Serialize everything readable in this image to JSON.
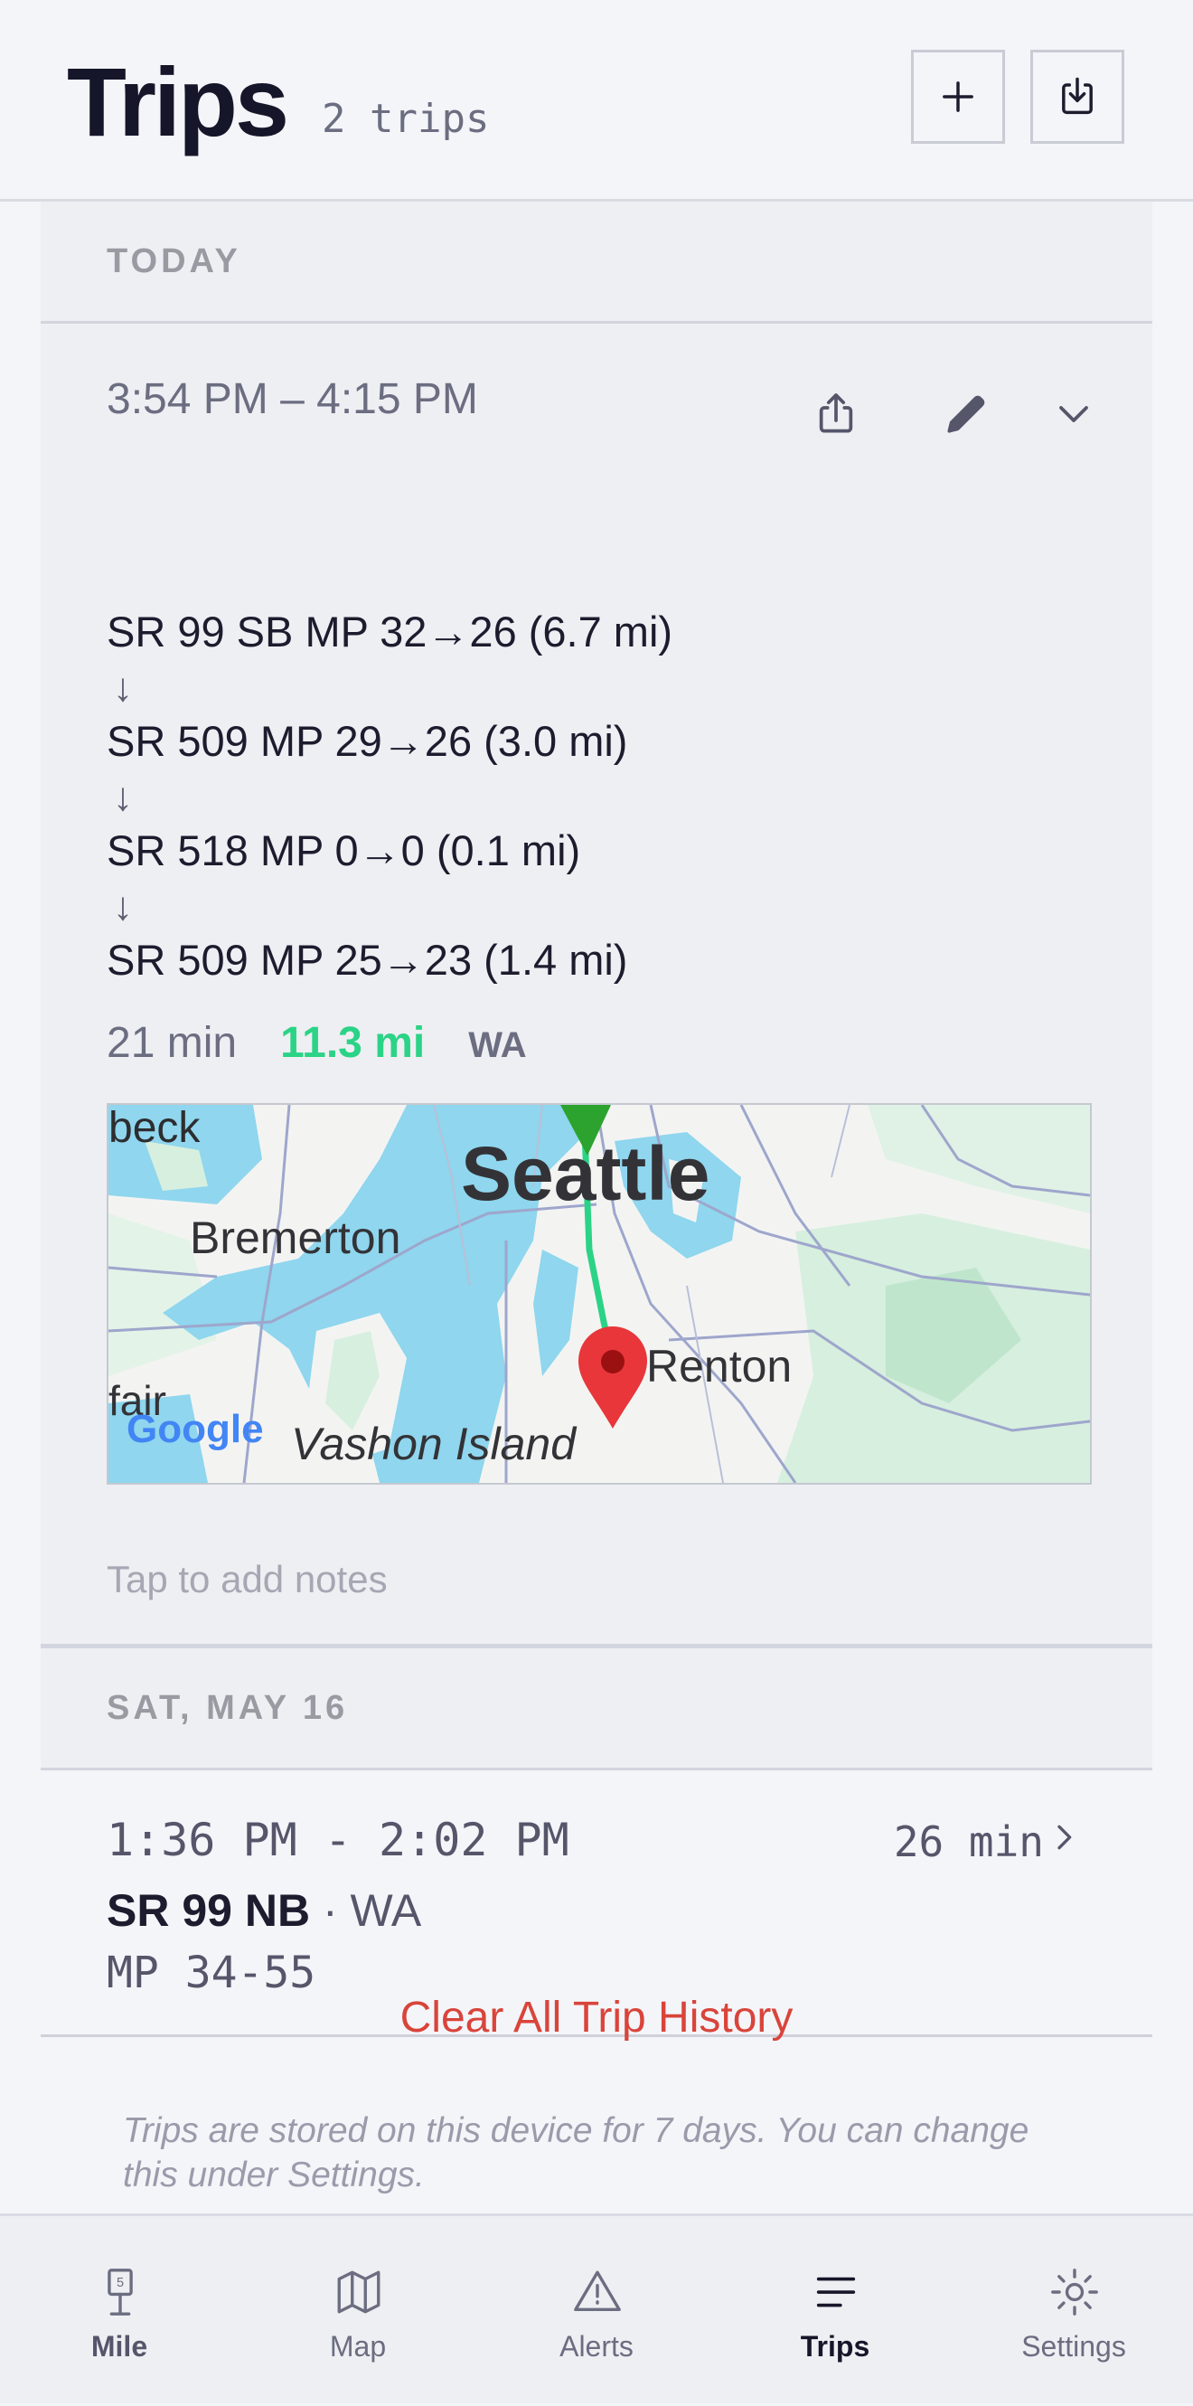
{
  "header": {
    "title": "Trips",
    "count": "2 trips"
  },
  "sections": [
    {
      "label": "TODAY",
      "trip": {
        "time_range": "3:54 PM – 4:15 PM",
        "segments": [
          "SR 99 SB MP 32→26 (6.7 mi)",
          "SR 509 MP 29→26 (3.0 mi)",
          "SR 518 MP 0→0 (0.1 mi)",
          "SR 509 MP 25→23 (1.4 mi)"
        ],
        "arrow": "↓",
        "duration": "21 min",
        "distance": "11.3 mi",
        "state": "WA",
        "map_labels": {
          "seattle": "Seattle",
          "bremerton": "Bremerton",
          "renton": "Renton",
          "vashon": "Vashon Island",
          "beck": "beck",
          "fair": "fair",
          "google": "Google"
        },
        "notes_placeholder": "Tap to add notes"
      }
    },
    {
      "label": "SAT, MAY 16",
      "trip": {
        "time_range": "1:36 PM - 2:02 PM",
        "duration": "26 min",
        "route": "SR 99 NB",
        "separator": " · ",
        "state": "WA",
        "mileposts": "MP 34-55"
      }
    }
  ],
  "clear_label": "Clear All Trip History",
  "info_text": "Trips are stored on this device for 7 days. You can change this under Settings.",
  "tabs": [
    {
      "label": "Mile",
      "icon": "milepost-icon"
    },
    {
      "label": "Map",
      "icon": "map-icon"
    },
    {
      "label": "Alerts",
      "icon": "alert-icon"
    },
    {
      "label": "Trips",
      "icon": "list-icon",
      "active": true
    },
    {
      "label": "Settings",
      "icon": "gear-icon"
    }
  ],
  "milepost_digit": "5",
  "colors": {
    "accent_green": "#2bd386",
    "danger_red": "#d9443a",
    "text_dark": "#16162a"
  }
}
